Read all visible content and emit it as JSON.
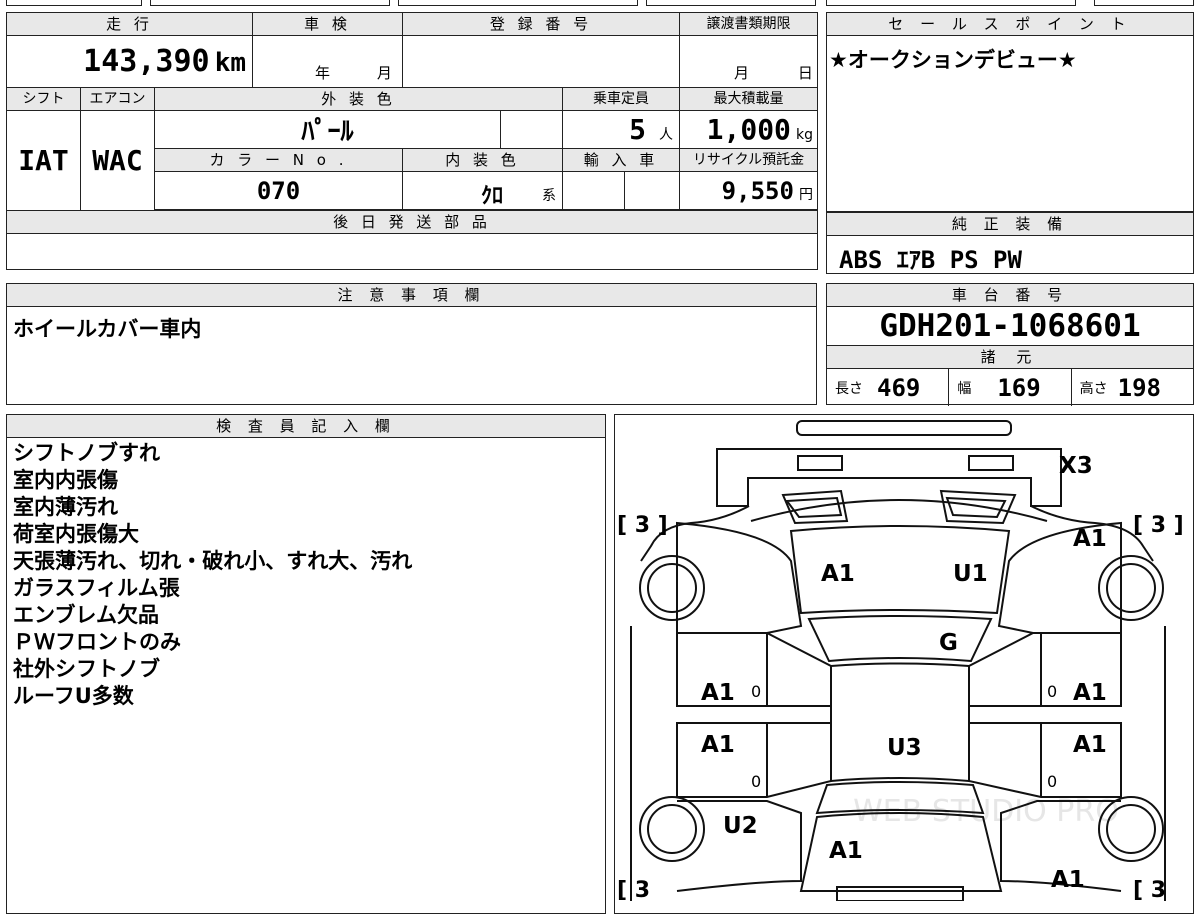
{
  "headers": {
    "mileage": "走 行",
    "inspection": "車 検",
    "registration": "登 録 番 号",
    "transfer_deadline": "譲渡書類期限",
    "shift": "シフト",
    "aircon": "エアコン",
    "exterior_color": "外 装 色",
    "capacity": "乗車定員",
    "max_load": "最大積載量",
    "color_no": "カ ラ ー N o .",
    "interior_color": "内 装 色",
    "import": "輸 入 車",
    "recycle": "リサイクル預託金",
    "later_parts": "後 日 発 送 部 品",
    "sales_point": "セ ー ル ス ポ イ ン ト",
    "equipment": "純 正 装 備",
    "notes": "注 意 事 項 欄",
    "chassis": "車 台 番 号",
    "specs": "諸 元",
    "inspector": "検 査 員 記 入 欄"
  },
  "values": {
    "mileage": "143,390",
    "mileage_unit": "km",
    "inspection_year_unit": "年",
    "inspection_month_unit": "月",
    "transfer_month_unit": "月",
    "transfer_day_unit": "日",
    "shift": "IAT",
    "aircon": "WAC",
    "exterior_color": "ﾊﾟｰﾙ",
    "capacity": "5",
    "capacity_unit": "人",
    "max_load": "1,000",
    "max_load_unit": "kg",
    "color_no": "070",
    "interior_color": "ｸﾛ",
    "interior_suffix": "系",
    "recycle": "9,550",
    "recycle_unit": "円",
    "sales_point": "★オークションデビュー★",
    "equipment": "ABS ｴｱB PS PW",
    "notes": "ホイールカバー車内",
    "chassis": "GDH201-1068601",
    "length_label": "長さ",
    "length": "469",
    "width_label": "幅",
    "width": "169",
    "height_label": "高さ",
    "height": "198"
  },
  "inspector_notes": [
    "シフトノブすれ",
    "室内内張傷",
    "室内薄汚れ",
    "荷室内張傷大",
    "天張薄汚れ、切れ・破れ小、すれ大、汚れ",
    "ガラスフィルム張",
    "エンブレム欠品",
    "ＰＷフロントのみ",
    "社外シフトノブ",
    "ルーフU多数"
  ],
  "diagram": {
    "marks": {
      "x3": "X3",
      "a1_right_front": "A1",
      "a1_hood_left": "A1",
      "u1_hood_right": "U1",
      "g_windshield": "G",
      "a1_left_front_door": "A1",
      "a1_right_front_door": "A1",
      "a1_left_rear_door": "A1",
      "a1_right_rear_door": "A1",
      "u3_roof": "U3",
      "u2_left_rear": "U2",
      "a1_rear": "A1",
      "a1_right_rear": "A1"
    },
    "tire_labels": {
      "front_left": "[ 3 ]",
      "front_right": "[ 3 ]",
      "rear_left": "[ 3",
      "rear_right": "[ 3"
    },
    "door_zero": "0",
    "watermark": "WEB STUDIO PRO"
  }
}
